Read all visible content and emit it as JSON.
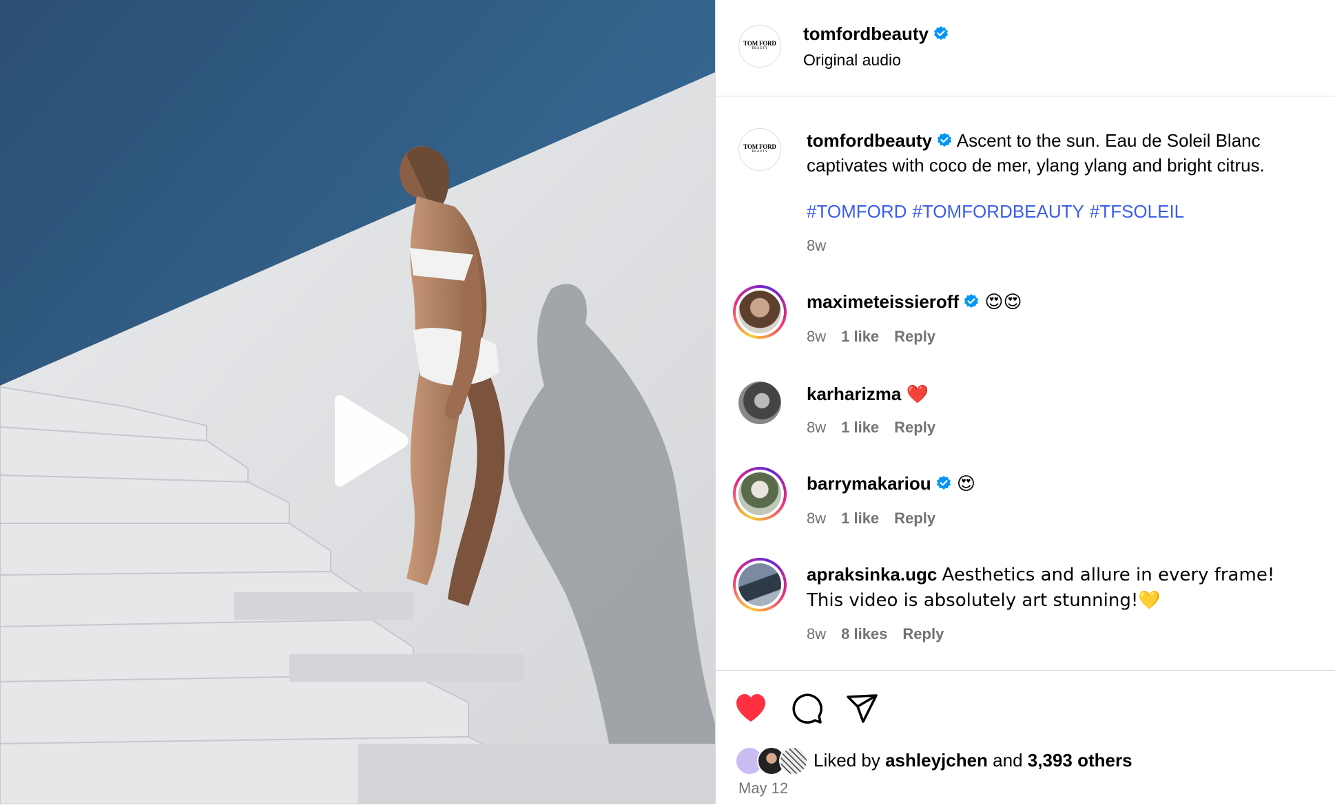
{
  "header": {
    "username": "tomfordbeauty",
    "subtitle": "Original audio",
    "logo_text_1": "TOM FORD",
    "logo_text_2": "BEAUTY"
  },
  "caption": {
    "username": "tomfordbeauty",
    "text": "Ascent to the sun. Eau de Soleil Blanc captivates with coco de mer, ylang ylang and bright citrus.",
    "hashtags": [
      "#TOMFORD",
      "#TOMFORDBEAUTY",
      "#TFSOLEIL"
    ],
    "age": "8w"
  },
  "comments": [
    {
      "username": "maximeteissieroff",
      "verified": true,
      "text": "😍😍",
      "age": "8w",
      "likes": "1 like",
      "reply": "Reply"
    },
    {
      "username": "karharizma",
      "verified": false,
      "text": "❤️",
      "age": "8w",
      "likes": "1 like",
      "reply": "Reply"
    },
    {
      "username": "barrymakariou",
      "verified": true,
      "text": "😍",
      "age": "8w",
      "likes": "1 like",
      "reply": "Reply"
    },
    {
      "username": "apraksinka.ugc",
      "verified": false,
      "text": "Aesthetics and allure in every frame! This video is absolutely art stunning!💛",
      "age": "8w",
      "likes": "8 likes",
      "reply": "Reply"
    }
  ],
  "footer": {
    "liked_prefix": "Liked by",
    "liked_user": "ashleyjchen",
    "liked_and": "and",
    "liked_others": "3,393 others",
    "date": "May 12"
  },
  "icons": {
    "like": "heart-icon",
    "comment": "comment-icon",
    "share": "share-icon",
    "play": "play-icon",
    "verified": "verified-badge-icon"
  },
  "colors": {
    "heart": "#ff3040",
    "verified": "#0095f6",
    "hashtag": "#3b5ee8",
    "muted": "#737373",
    "sky": "#2e5a7e"
  }
}
